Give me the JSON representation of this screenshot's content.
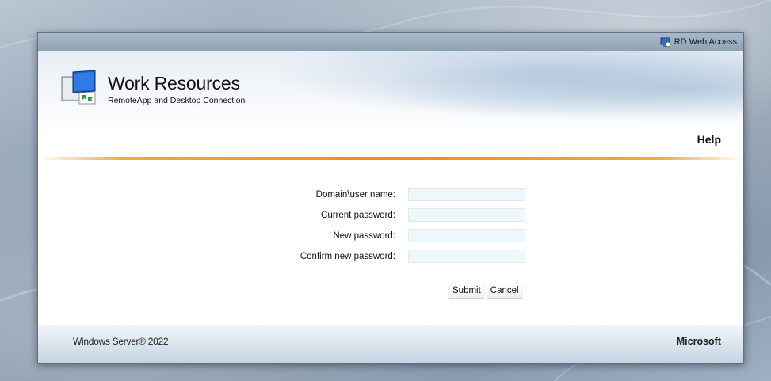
{
  "topbar": {
    "label": "RD Web Access",
    "icon": "rd-web-access-icon"
  },
  "header": {
    "title": "Work Resources",
    "subtitle": "RemoteApp and Desktop Connection",
    "logo_icon": "remote-desktop-icon",
    "help_label": "Help",
    "accent_line_color": "#f28c1e"
  },
  "form": {
    "fields": [
      {
        "label": "Domain\\user name:",
        "value": ""
      },
      {
        "label": "Current password:",
        "value": ""
      },
      {
        "label": "New password:",
        "value": ""
      },
      {
        "label": "Confirm new password:",
        "value": ""
      }
    ],
    "submit_label": "Submit",
    "cancel_label": "Cancel",
    "input_background": "#eef8fb"
  },
  "footer": {
    "left": "Windows Server® 2022",
    "right": "Microsoft"
  }
}
